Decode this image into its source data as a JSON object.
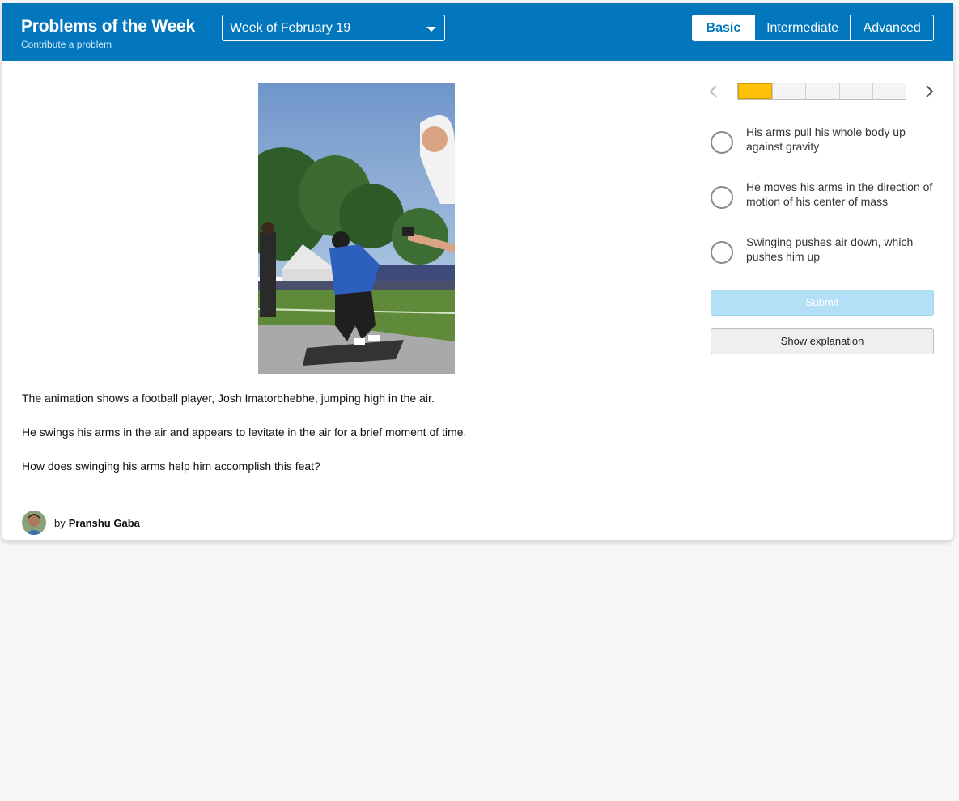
{
  "header": {
    "title": "Problems of the Week",
    "contribute_link": "Contribute a problem",
    "week_select": {
      "selected": "Week of February 19"
    },
    "levels": [
      {
        "label": "Basic",
        "active": true
      },
      {
        "label": "Intermediate",
        "active": false
      },
      {
        "label": "Advanced",
        "active": false
      }
    ]
  },
  "problem": {
    "media_alt": "football player jumping animation",
    "paragraphs": [
      "The animation shows a football player, Josh Imatorbhebhe, jumping high in the air.",
      "He swings his arms in the air and appears to levitate in the air for a brief moment of time.",
      "How does swinging his arms help him accomplish this feat?"
    ],
    "author": {
      "by": "by",
      "name": "Pranshu Gaba"
    }
  },
  "quiz": {
    "progress": {
      "current_step": 1,
      "total_steps": 5
    },
    "choices": [
      "His arms pull his whole body up against gravity",
      "He moves his arms in the direction of motion of his center of mass",
      "Swinging pushes air down, which pushes him up"
    ],
    "submit_label": "Submit",
    "explanation_label": "Show explanation"
  },
  "colors": {
    "brand": "#0277bd",
    "progress_current": "#ffc107",
    "submit_disabled": "#b3e0f7",
    "page_bg": "#f6f6f6"
  },
  "icons": [
    "chevron-left-icon",
    "chevron-right-icon",
    "caret-down-icon"
  ]
}
